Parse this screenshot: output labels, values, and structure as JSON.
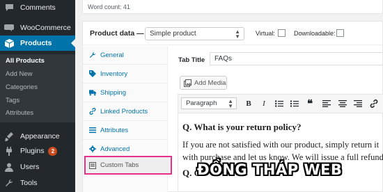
{
  "sidebar": {
    "top_items": [
      {
        "label": "Comments",
        "icon": "comment-bubble-icon"
      },
      {
        "label": "WooCommerce",
        "icon": "woocommerce-icon"
      },
      {
        "label": "Products",
        "icon": "product-box-icon"
      }
    ],
    "submenu": [
      "All Products",
      "Add New",
      "Categories",
      "Tags",
      "Attributes"
    ],
    "bottom_items": [
      {
        "label": "Appearance",
        "icon": "paintbrush-icon"
      },
      {
        "label": "Plugins",
        "icon": "plug-icon",
        "badge": "2"
      },
      {
        "label": "Users",
        "icon": "user-icon"
      },
      {
        "label": "Tools",
        "icon": "wrench-icon"
      }
    ]
  },
  "editor": {
    "word_count": "Word count: 41"
  },
  "product_data": {
    "label": "Product data —",
    "type_selected": "Simple product",
    "virtual_label": "Virtual:",
    "downloadable_label": "Downloadable:",
    "tabs": [
      {
        "label": "General",
        "icon": "wrench-icon"
      },
      {
        "label": "Inventory",
        "icon": "tag-icon"
      },
      {
        "label": "Shipping",
        "icon": "truck-icon"
      },
      {
        "label": "Linked Products",
        "icon": "link-icon"
      },
      {
        "label": "Attributes",
        "icon": "list-icon"
      },
      {
        "label": "Advanced",
        "icon": "gear-icon"
      },
      {
        "label": "Custom Tabs",
        "icon": "tabs-icon"
      }
    ]
  },
  "custom_tab": {
    "title_label": "Tab Title",
    "title_value": "FAQs",
    "add_media": "Add Media",
    "format_selected": "Paragraph",
    "question1": "Q. What is your return policy?",
    "answer1": "If you are not satisfied with our product, simply return it with purchase and let us know. We will issue a full refund.",
    "question2": "Q. C"
  },
  "watermark": "ĐỒNG THÁP WEB",
  "colors": {
    "admin_bg": "#23282d",
    "accent": "#0073aa",
    "highlight_border": "#e8308a",
    "badge": "#ca4a1f"
  }
}
